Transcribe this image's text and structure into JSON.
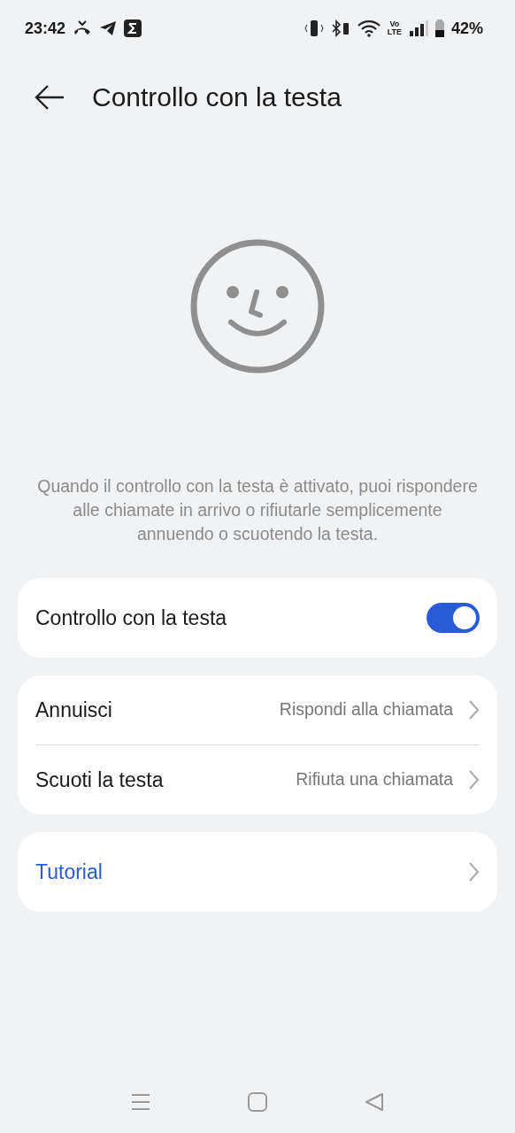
{
  "status_bar": {
    "time": "23:42",
    "network_label_top": "Vo",
    "network_label_bottom": "LTE",
    "battery": "42%"
  },
  "header": {
    "title": "Controllo con la testa"
  },
  "description": "Quando il controllo con la testa è attivato, puoi rispondere alle chiamate in arrivo o rifiutarle semplicemente annuendo o scuotendo la testa.",
  "toggle_card": {
    "label": "Controllo con la testa",
    "on": true
  },
  "gestures": [
    {
      "label": "Annuisci",
      "value": "Rispondi alla chiamata"
    },
    {
      "label": "Scuoti la testa",
      "value": "Rifiuta una chiamata"
    }
  ],
  "tutorial": {
    "label": "Tutorial"
  }
}
